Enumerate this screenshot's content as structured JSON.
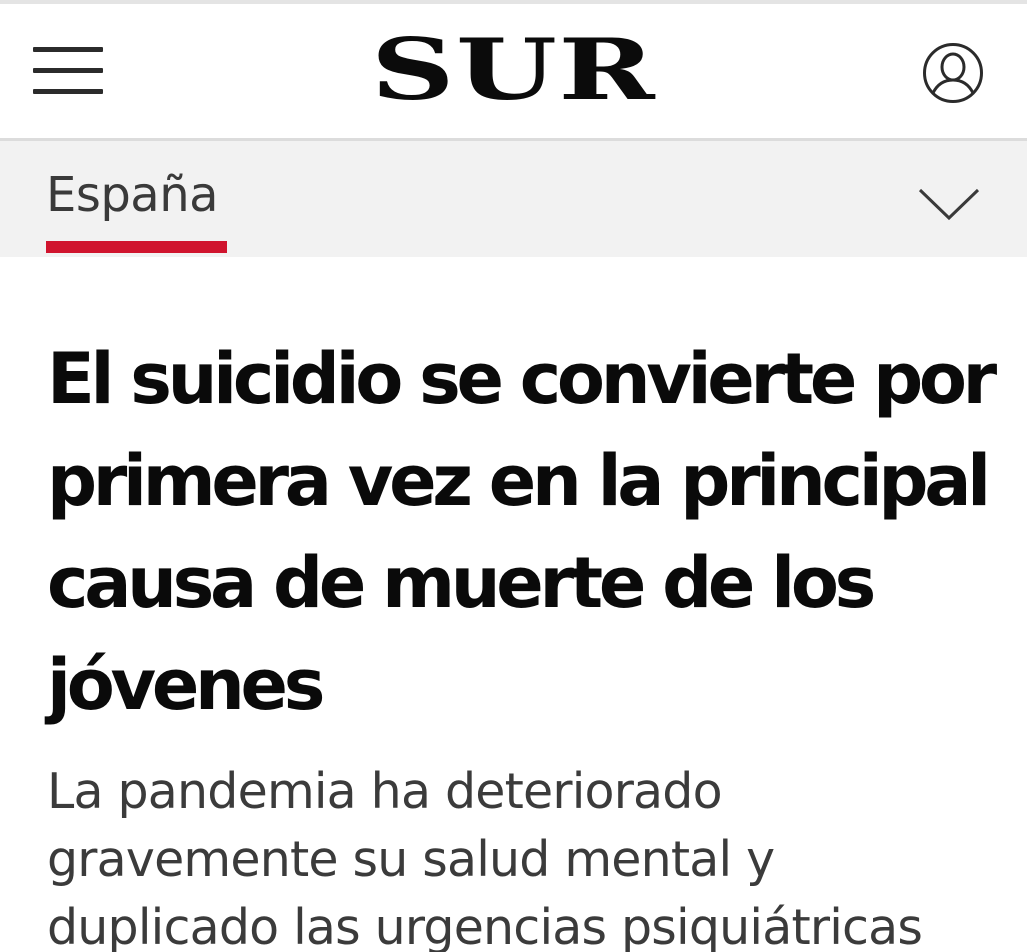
{
  "header": {
    "logo": "SUR",
    "menu_icon": "hamburger-menu-icon",
    "user_icon": "user-account-icon"
  },
  "section": {
    "label": "España",
    "expand_icon": "chevron-down-icon",
    "accent_color": "#d0142e"
  },
  "article": {
    "headline": "El suicidio se convierte por primera vez en la principal causa de muerte de los jóvenes",
    "subheadline": "La pandemia ha deteriorado gravemente su salud mental y duplicado las urgencias psiquiátricas"
  }
}
